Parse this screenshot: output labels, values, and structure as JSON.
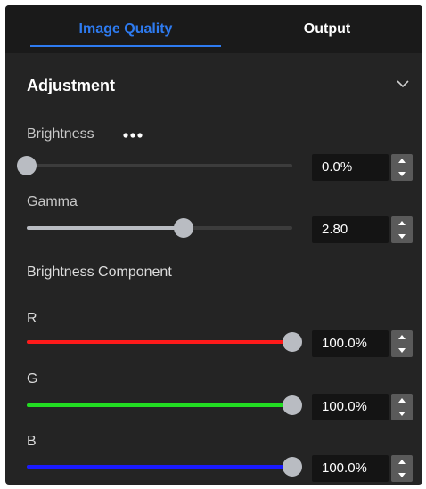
{
  "tabs": [
    {
      "label": "Image Quality",
      "active": true
    },
    {
      "label": "Output",
      "active": false
    }
  ],
  "section": {
    "title": "Adjustment",
    "collapse_icon": "chevron-down-icon"
  },
  "brightness": {
    "label": "Brightness",
    "more_icon": "more-horizontal-icon",
    "value": "0.0%",
    "level": 0.0
  },
  "gamma": {
    "label": "Gamma",
    "value": "2.80",
    "level": 0.59
  },
  "component": {
    "title": "Brightness Component",
    "channels": [
      {
        "label": "R",
        "value": "100.0%",
        "level": 1.0,
        "color": "#ff1a1a"
      },
      {
        "label": "G",
        "value": "100.0%",
        "level": 1.0,
        "color": "#22dd22"
      },
      {
        "label": "B",
        "value": "100.0%",
        "level": 1.0,
        "color": "#1a1aff"
      }
    ]
  },
  "colors": {
    "accent": "#2e7bf0",
    "panel": "#242424",
    "neutral_fill": "#b9bcc2"
  }
}
